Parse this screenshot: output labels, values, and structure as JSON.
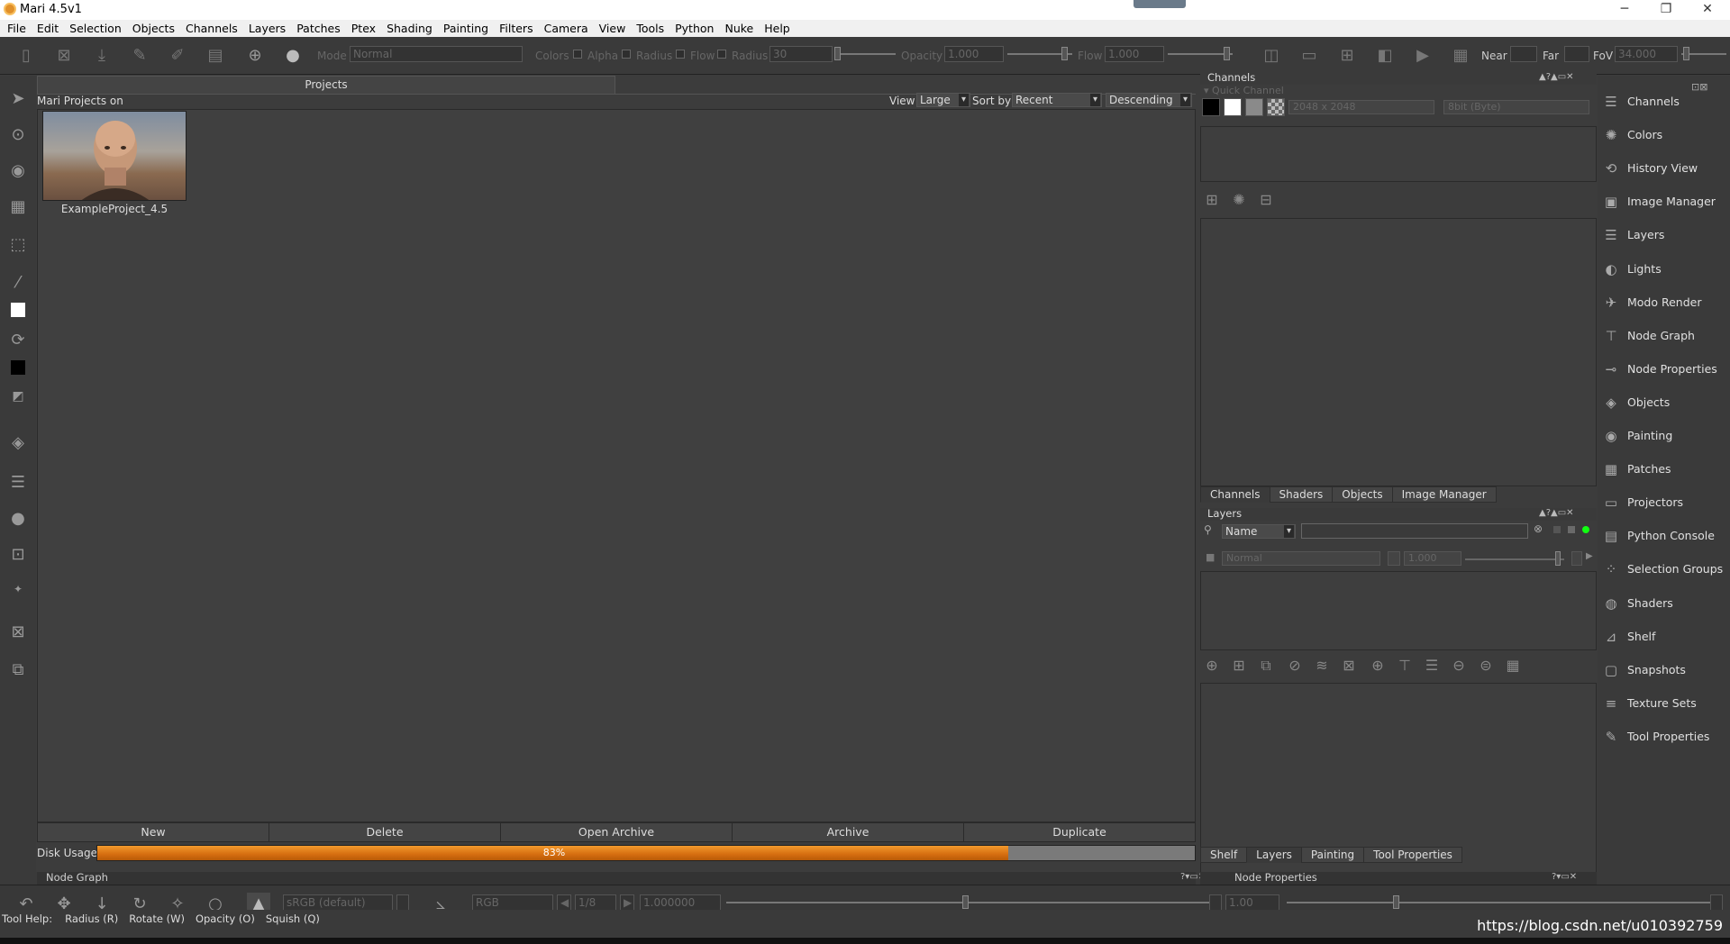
{
  "window": {
    "title": "Mari 4.5v1"
  },
  "menu": [
    "File",
    "Edit",
    "Selection",
    "Objects",
    "Channels",
    "Layers",
    "Patches",
    "Ptex",
    "Shading",
    "Painting",
    "Filters",
    "Camera",
    "View",
    "Tools",
    "Python",
    "Nuke",
    "Help"
  ],
  "toolbar": {
    "mode_label": "Mode",
    "mode_value": "Normal",
    "colors_label": "Colors",
    "alpha_label": "Alpha",
    "radius_label": "Radius",
    "flow_label": "Flow",
    "radius2_label": "Radius",
    "radius_value": "30",
    "opacity_label": "Opacity",
    "opacity_value": "1.000",
    "flow2_label": "Flow",
    "flow_value": "1.000",
    "near_label": "Near",
    "far_label": "Far",
    "fov_label": "FoV",
    "fov_value": "34.000"
  },
  "projects": {
    "tab": "Projects",
    "header": "Mari Projects on",
    "view_label": "View",
    "view_value": "Large",
    "sort_label": "Sort by",
    "sort_value": "Recent",
    "order_value": "Descending",
    "items": [
      {
        "name": "ExampleProject_4.5"
      }
    ],
    "buttons": {
      "new": "New",
      "delete": "Delete",
      "open_archive": "Open Archive",
      "archive": "Archive",
      "duplicate": "Duplicate"
    },
    "disk_label": "Disk Usage",
    "disk_percent_text": "83%",
    "disk_fraction": 0.83
  },
  "channels_panel": {
    "title": "Channels",
    "quick_channel": "Quick Channel",
    "size_value": "2048 x 2048",
    "depth_value": "8bit (Byte)",
    "tabs": [
      "Channels",
      "Shaders",
      "Objects",
      "Image Manager"
    ]
  },
  "layers_panel": {
    "title": "Layers",
    "filter_value": "Name",
    "blend_value": "Normal",
    "opacity_value": "1.000",
    "tabs": [
      "Shelf",
      "Layers",
      "Painting",
      "Tool Properties"
    ],
    "active_tab": "Layers"
  },
  "side_dock": [
    "Channels",
    "Colors",
    "History View",
    "Image Manager",
    "Layers",
    "Lights",
    "Modo Render",
    "Node Graph",
    "Node Properties",
    "Objects",
    "Painting",
    "Patches",
    "Projectors",
    "Python Console",
    "Selection Groups",
    "Shaders",
    "Shelf",
    "Snapshots",
    "Texture Sets",
    "Tool Properties"
  ],
  "bottom": {
    "node_graph_title": "Node Graph",
    "node_props_title": "Node Properties",
    "colorspace_value": "sRGB (default)",
    "rgb_value": "RGB",
    "frame_value": "1/8",
    "gain_value": "1.000000",
    "gamma_value": "1.00"
  },
  "status": {
    "tool_help": "Tool Help:",
    "hints": [
      "Radius (R)",
      "Rotate (W)",
      "Opacity (O)",
      "Squish (Q)"
    ],
    "watermark": "https://blog.csdn.net/u010392759"
  }
}
